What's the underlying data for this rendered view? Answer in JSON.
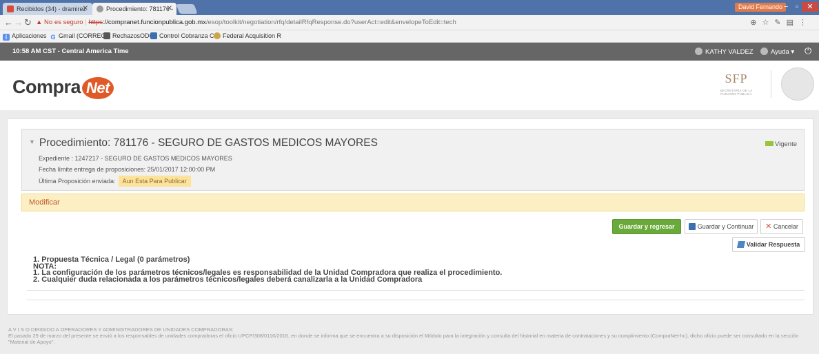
{
  "browser": {
    "tabs": [
      {
        "title": "Recibidos (34) - dramirez",
        "icon_color": "#d84a3a"
      },
      {
        "title": "Procedimiento: 781176 -",
        "icon_color": "#9a9a9a"
      }
    ],
    "user_chip": "David Fernando",
    "url": {
      "warning": "No es seguro",
      "scheme": "https",
      "domain": "://compranet.funcionpublica.gob.mx",
      "path": "/esop/toolkit/negotiation/rfq/detailRfqResponse.do?userAct=edit&envelopeToEdit=tech"
    },
    "bookmarks": [
      "Aplicaciones",
      "Gmail (CORREO)",
      "RechazosODC",
      "Control Cobranza Co",
      "Federal Acquisition R"
    ]
  },
  "site": {
    "time": "10:58 AM CST - Central America Time",
    "user": "KATHY VALDEZ",
    "help": "Ayuda",
    "logo_text": "Compra",
    "logo_net": "Net",
    "agency": "SFP",
    "agency_sub": "SECRETARÍA DE LA FUNCIÓN PÚBLICA"
  },
  "procedure": {
    "title": "Procedimiento: 781176 - SEGURO DE GASTOS MEDICOS MAYORES",
    "expediente": "Expediente : 1247217 - SEGURO DE GASTOS MEDICOS MAYORES",
    "fecha": "Fecha límite entrega de proposiciones: 25/01/2017 12:00:00 PM",
    "ultima_label": "Última Proposición enviada:",
    "ultima_status": "Aun Esta Para Publicar",
    "vigente": "Vigente"
  },
  "modificar": "Modificar",
  "buttons": {
    "guardar_regresar": "Guardar y regresar",
    "guardar_continuar": "Guardar y Continuar",
    "cancelar": "Cancelar",
    "validar": "Validar Respuesta"
  },
  "notes": [
    "1. Propuesta Técnica / Legal (0 parámetros)",
    "NOTA:",
    "1. La configuración de los parámetros técnicos/legales es responsabilidad de la Unidad Compradora que realiza el procedimiento.",
    "2. Cualquier duda relacionada a los parámetros técnicos/legales deberá canalizarla a la Unidad Compradora"
  ],
  "footer": {
    "line1": "A V I S O DIRIGIDO A OPERADORES Y ADMINISTRADORES DE UNIDADES COMPRADORAS:",
    "line2": "El pasado 29 de marzo del presente se envió a los responsables de unidades compradoras el oficio UPCP/308/0116/2016, en donde se informa que se encuentra a su disposición el Módulo para la integración y consulta del historial en materia de contrataciones y su cumplimiento (CompraNet-hc), dicho oficio puede ser consultado en la sección",
    "line3": "\"Material de Apoyo\"."
  }
}
